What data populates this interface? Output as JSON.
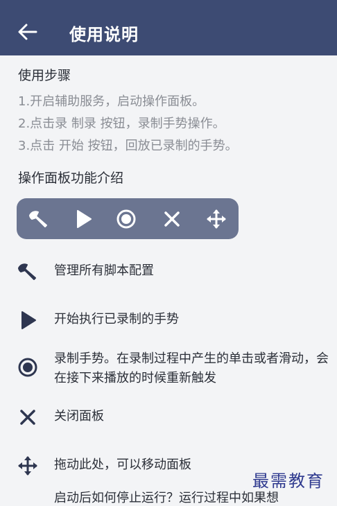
{
  "appbar": {
    "title": "使用说明"
  },
  "usage": {
    "title": "使用步骤",
    "steps": [
      "1.开启辅助服务，启动操作面板。",
      "2.点击录 制录 按钮，录制手势操作。",
      "3.点击 开始 按钮，回放已录制的手势。"
    ]
  },
  "panel_intro": {
    "title": "操作面板功能介绍"
  },
  "panel_icons": [
    "wrench-icon",
    "play-icon",
    "record-icon",
    "close-icon",
    "move-icon"
  ],
  "features": [
    {
      "icon": "wrench-icon",
      "text": "管理所有脚本配置"
    },
    {
      "icon": "play-icon",
      "text": "开始执行已录制的手势"
    },
    {
      "icon": "record-icon",
      "text": "录制手势。在录制过程中产生的单击或者滑动，会在接下来播放的时候重新触发"
    },
    {
      "icon": "close-icon",
      "text": "关闭面板"
    },
    {
      "icon": "move-icon",
      "text": "拖动此处，可以移动面板"
    }
  ],
  "cutoff_text": "启动后如何停止运行？运行过程中如果想",
  "watermark": "最需教育",
  "colors": {
    "appbar": "#3d4b73",
    "panel": "#6b7591",
    "icon_dark": "#2e3650"
  }
}
